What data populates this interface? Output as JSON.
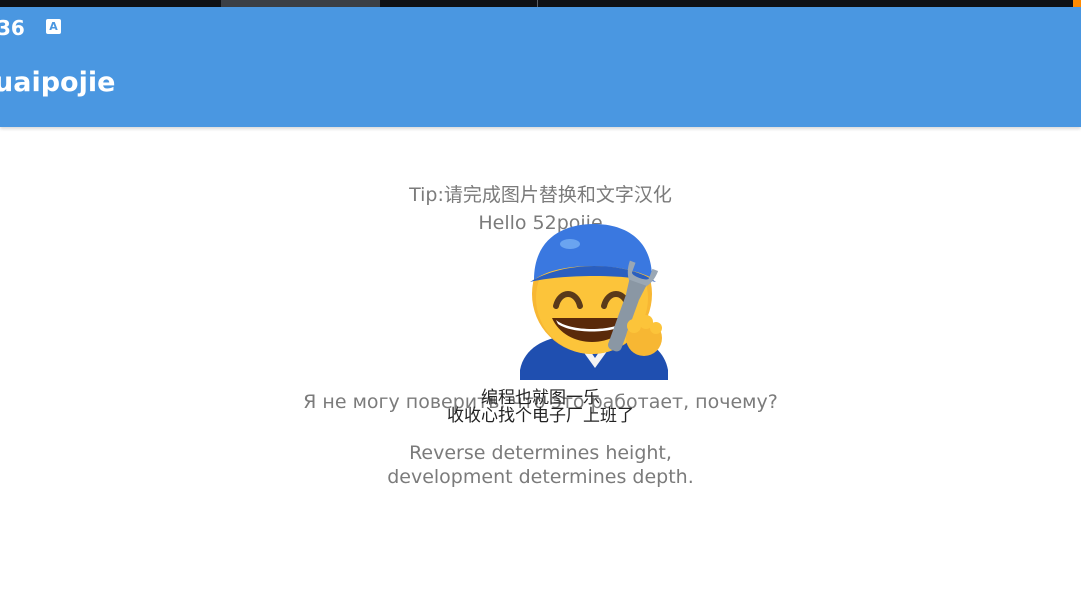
{
  "status_bar": {
    "time": ":36",
    "icon_letter": "A"
  },
  "app_bar": {
    "title": "uaipojie",
    "color": "#4a97e1"
  },
  "content": {
    "tip": "Tip:请完成图片替换和文字汉化",
    "hello": "Hello 52pojie",
    "caption_line1": "编程也就图一乐",
    "caption_line2": "收收心找个电子厂上班了",
    "russian": "Я не могу поверить, что это работает, почему?",
    "reverse_line1": "Reverse determines height,",
    "reverse_line2": "development determines depth.",
    "image_icon": "mechanic-emoji-icon"
  }
}
